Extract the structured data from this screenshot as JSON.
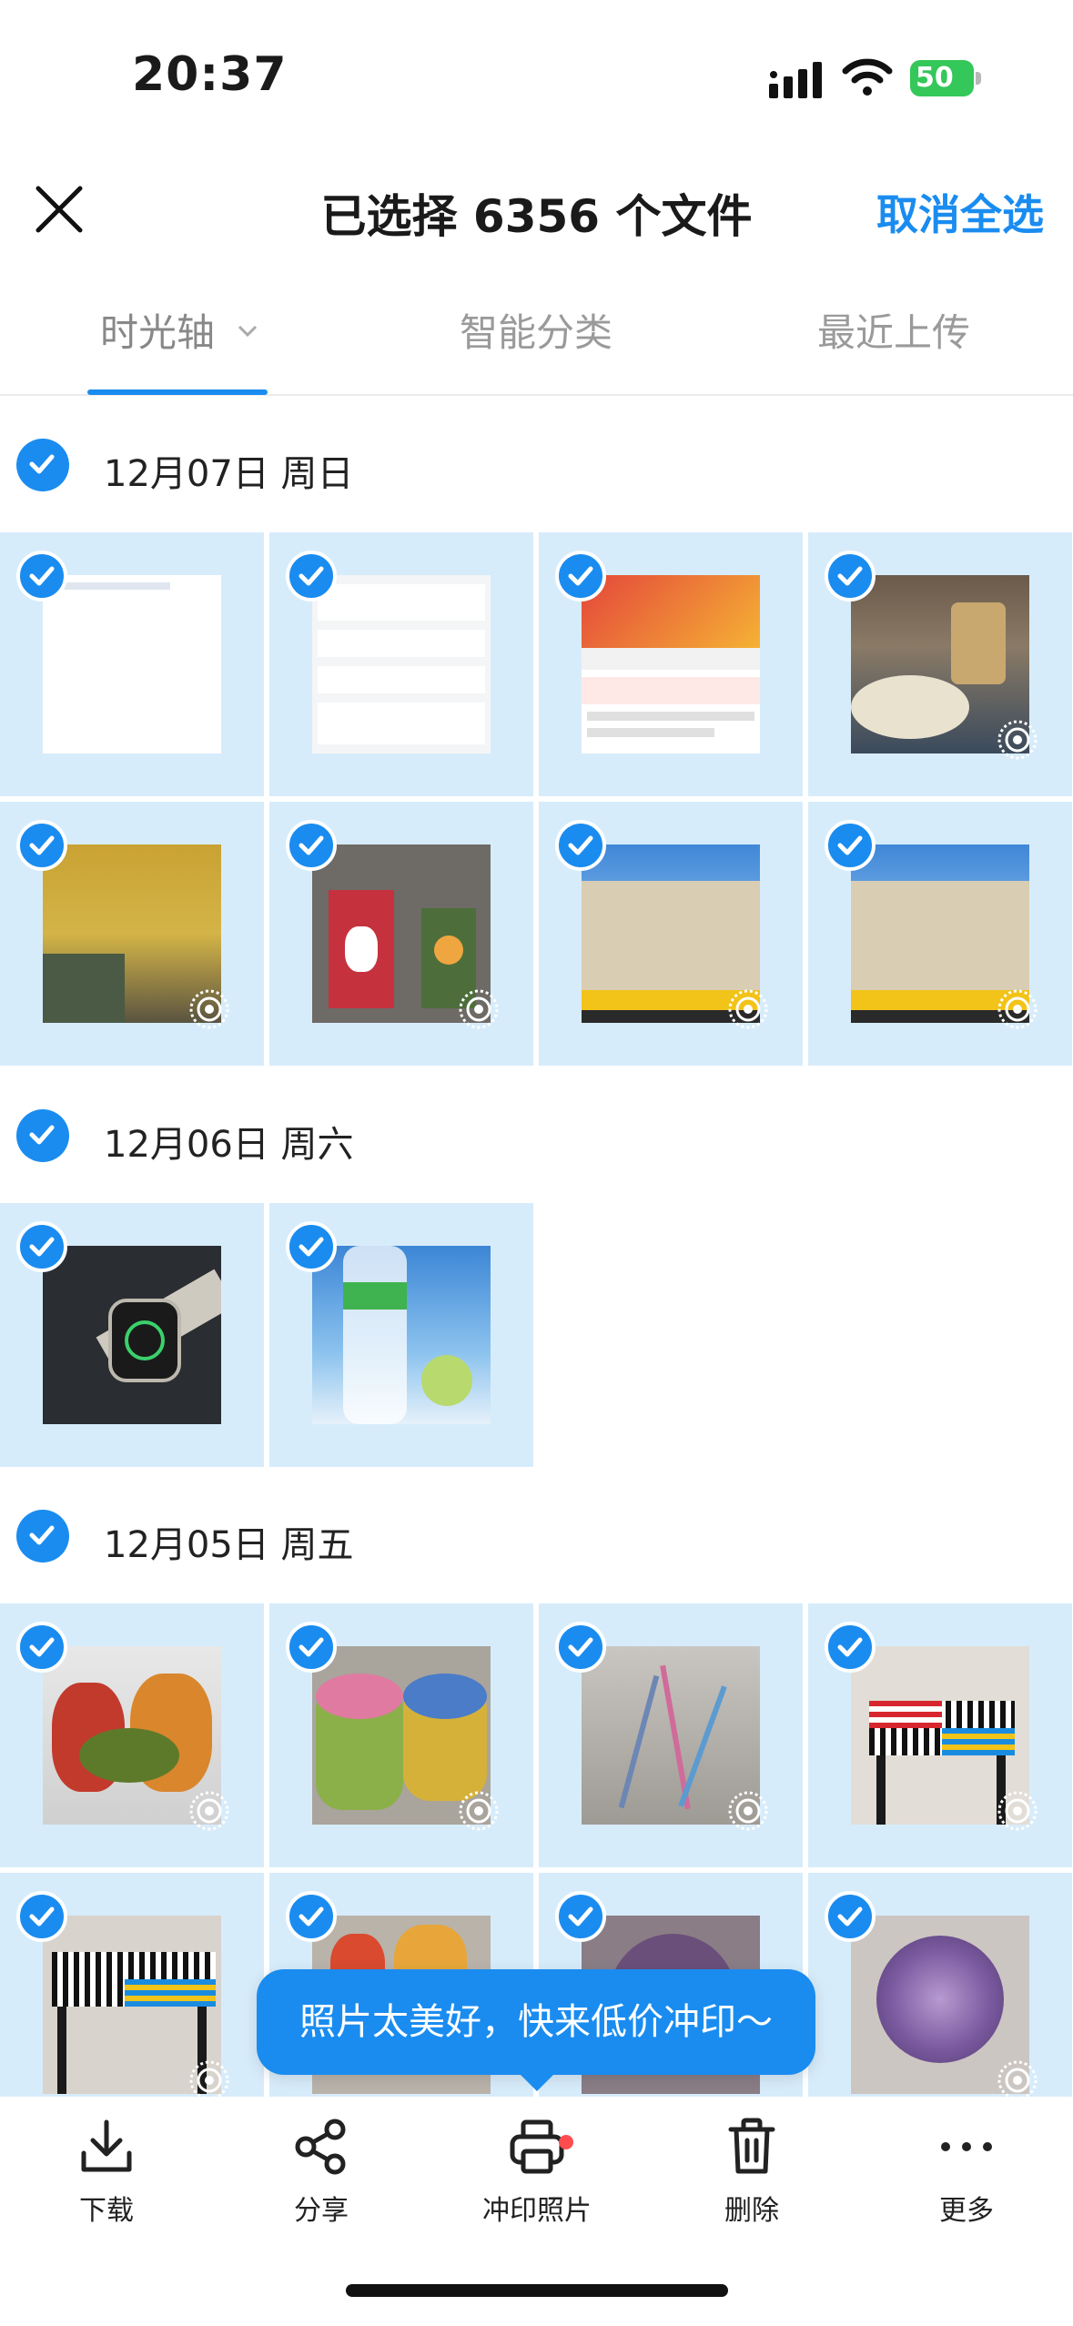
{
  "status_bar": {
    "time": "20:37",
    "battery": "50"
  },
  "header": {
    "title": "已选择 6356 个文件",
    "deselect_all": "取消全选"
  },
  "tabs": [
    {
      "label": "时光轴"
    },
    {
      "label": "智能分类"
    },
    {
      "label": "最近上传"
    }
  ],
  "sections": [
    {
      "date": "12月07日 周日",
      "item_count": 8
    },
    {
      "date": "12月06日 周六",
      "item_count": 2
    },
    {
      "date": "12月05日 周五",
      "item_count": 8
    }
  ],
  "tooltip": {
    "text": "照片太美好，快来低价冲印～"
  },
  "toolbar": {
    "download": "下载",
    "share": "分享",
    "print": "冲印照片",
    "delete": "删除",
    "more": "更多"
  },
  "colors": {
    "accent": "#1a8cf0",
    "tile_bg": "#d7ecfb",
    "battery": "#34c759",
    "badge": "#ff4d4f"
  }
}
